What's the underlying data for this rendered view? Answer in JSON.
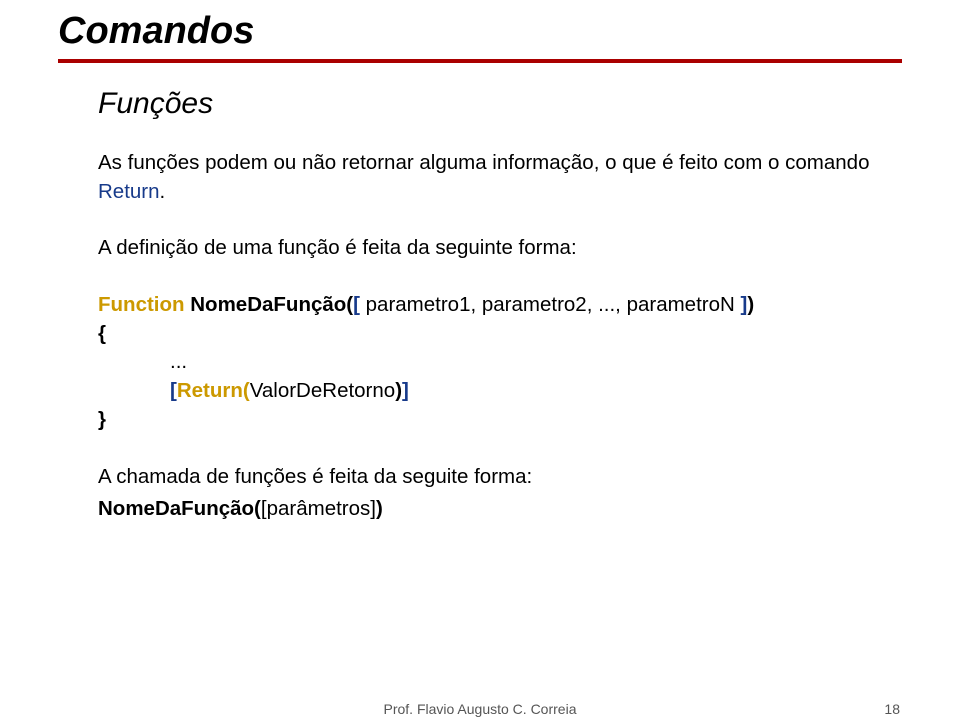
{
  "title": "Comandos",
  "subtitle": "Funções",
  "para1_1": "As funções podem ou não retornar alguma informação, o que é feito com o comando ",
  "para1_return": "Return",
  "para1_dot": ".",
  "para2": "A definição de uma função é feita da seguinte forma:",
  "code": {
    "function_kw": "Function",
    "func_name_open": " NomeDaFunção(",
    "open_sq": "[",
    "params": " parametro1, parametro2, ..., parametroN ",
    "close_sq": "]",
    "close_paren": ")",
    "brace_open": "{",
    "ellipsis": "...",
    "return_open": "[",
    "return_kw": "Return(",
    "return_val": "ValorDeRetorno",
    "return_close_paren": ")",
    "return_close_sq": "]",
    "brace_close": "}"
  },
  "para3_1": "A chamada de funções é feita da seguite forma:",
  "call": {
    "name_open": "NomeDaFunção(",
    "params": "[parâmetros]",
    "close": ")"
  },
  "footer_author": "Prof. Flavio Augusto C. Correia",
  "footer_page": "18"
}
